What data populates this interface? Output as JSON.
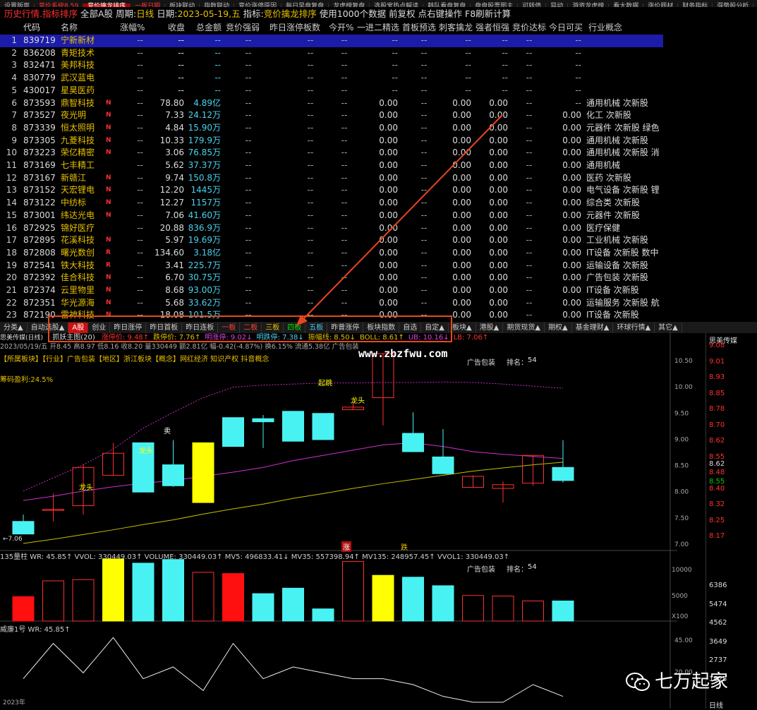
{
  "top_menu": [
    "设置版面",
    "竞价系统8.59",
    "竞价擒龙排序",
    "一板日期",
    "板块联动",
    "指数联动",
    "竞价涨停原因",
    "每日早盘复盘",
    "龙虎榜复盘",
    "选股宝热点解读",
    "韩队看盘复盘",
    "盘盘股票图主",
    "可转债",
    "异动",
    "游资龙虎榜",
    "看大数据",
    "涨价题材",
    "财务指标",
    "强势股分析",
    "主力"
  ],
  "infobar": {
    "a": "历史行情.指标排序",
    "b": "全部A股",
    "c": "周期:",
    "d": "日线",
    "e": "日期:",
    "f": "2023-05-19,五",
    "g": "指标:",
    "h": "竞价擒龙排序",
    "i": "使用1000个数据 前复权 点右键操作 F8刷新计算"
  },
  "table": {
    "headers": {
      "code": "代码",
      "name": "名称",
      "pct": "涨幅%",
      "close": "收盘",
      "mkt": "总金额",
      "amp": "竞价强弱",
      "boards": "昨日涨停板数",
      "open": "今开%",
      "j12": "一进二精选",
      "fboard": "首板预选",
      "dragon": "刺客擒龙",
      "strong": "强者恒强",
      "bid": "竞价达标",
      "buyable": "今日可买",
      "concept": "行业概念"
    },
    "rows": [
      {
        "idx": "1",
        "code": "839719",
        "name": "宁新新材",
        "flag": "",
        "pct": "--",
        "close": "--",
        "mkt": "--",
        "amp": "--",
        "boards": "--",
        "open": "--",
        "j12": "--",
        "fboard": "--",
        "dragon": "--",
        "strong": "--",
        "bid": "--",
        "buyable": "--",
        "concept": ""
      },
      {
        "idx": "2",
        "code": "836208",
        "name": "青矩技术",
        "flag": "",
        "pct": "--",
        "close": "--",
        "mkt": "--",
        "amp": "--",
        "boards": "--",
        "open": "--",
        "j12": "--",
        "fboard": "--",
        "dragon": "--",
        "strong": "--",
        "bid": "--",
        "buyable": "--",
        "concept": ""
      },
      {
        "idx": "3",
        "code": "832471",
        "name": "美邦科技",
        "flag": "",
        "pct": "--",
        "close": "--",
        "mkt": "--",
        "amp": "--",
        "boards": "--",
        "open": "--",
        "j12": "--",
        "fboard": "--",
        "dragon": "--",
        "strong": "--",
        "bid": "--",
        "buyable": "--",
        "concept": ""
      },
      {
        "idx": "4",
        "code": "830779",
        "name": "武汉蓝电",
        "flag": "",
        "pct": "--",
        "close": "--",
        "mkt": "--",
        "amp": "--",
        "boards": "--",
        "open": "--",
        "j12": "--",
        "fboard": "--",
        "dragon": "--",
        "strong": "--",
        "bid": "--",
        "buyable": "--",
        "concept": ""
      },
      {
        "idx": "5",
        "code": "430017",
        "name": "星昊医药",
        "flag": "",
        "pct": "--",
        "close": "--",
        "mkt": "--",
        "amp": "--",
        "boards": "--",
        "open": "--",
        "j12": "--",
        "fboard": "--",
        "dragon": "--",
        "strong": "--",
        "bid": "--",
        "buyable": "--",
        "concept": ""
      },
      {
        "idx": "6",
        "code": "873593",
        "name": "鼎智科技",
        "flag": "N",
        "pct": "--",
        "close": "78.80",
        "mkt": "4.89亿",
        "amp": "--",
        "boards": "--",
        "open": "--",
        "j12": "0.00",
        "fboard": "--",
        "dragon": "0.00",
        "strong": "0.00",
        "bid": "--",
        "buyable": "--",
        "concept": "通用机械  次新股"
      },
      {
        "idx": "7",
        "code": "873527",
        "name": "夜光明",
        "flag": "N",
        "pct": "--",
        "close": "7.33",
        "mkt": "24.12万",
        "amp": "--",
        "boards": "--",
        "open": "--",
        "j12": "0.00",
        "fboard": "--",
        "dragon": "0.00",
        "strong": "0.00",
        "bid": "--",
        "buyable": "0.00",
        "concept": "化工  次新股"
      },
      {
        "idx": "8",
        "code": "873339",
        "name": "恒太照明",
        "flag": "N",
        "pct": "--",
        "close": "4.84",
        "mkt": "15.90万",
        "amp": "--",
        "boards": "--",
        "open": "--",
        "j12": "0.00",
        "fboard": "--",
        "dragon": "0.00",
        "strong": "0.00",
        "bid": "--",
        "buyable": "0.00",
        "concept": "元器件  次新股 绿色"
      },
      {
        "idx": "9",
        "code": "873305",
        "name": "九菱科技",
        "flag": "N",
        "pct": "--",
        "close": "10.33",
        "mkt": "179.9万",
        "amp": "--",
        "boards": "--",
        "open": "--",
        "j12": "0.00",
        "fboard": "--",
        "dragon": "0.00",
        "strong": "0.00",
        "bid": "--",
        "buyable": "0.00",
        "concept": "通用机械  次新股"
      },
      {
        "idx": "10",
        "code": "873223",
        "name": "荣亿精密",
        "flag": "N",
        "pct": "--",
        "close": "3.06",
        "mkt": "76.85万",
        "amp": "--",
        "boards": "--",
        "open": "--",
        "j12": "0.00",
        "fboard": "--",
        "dragon": "0.00",
        "strong": "0.00",
        "bid": "--",
        "buyable": "0.00",
        "concept": "通用机械  次新股 消"
      },
      {
        "idx": "11",
        "code": "873169",
        "name": "七丰精工",
        "flag": "",
        "pct": "--",
        "close": "5.62",
        "mkt": "37.37万",
        "amp": "--",
        "boards": "--",
        "open": "--",
        "j12": "0.00",
        "fboard": "--",
        "dragon": "0.00",
        "strong": "0.00",
        "bid": "--",
        "buyable": "0.00",
        "concept": "通用机械"
      },
      {
        "idx": "12",
        "code": "873167",
        "name": "新赣江",
        "flag": "N",
        "pct": "--",
        "close": "9.74",
        "mkt": "150.8万",
        "amp": "--",
        "boards": "--",
        "open": "--",
        "j12": "0.00",
        "fboard": "--",
        "dragon": "0.00",
        "strong": "0.00",
        "bid": "--",
        "buyable": "0.00",
        "concept": "医药  次新股"
      },
      {
        "idx": "13",
        "code": "873152",
        "name": "天宏锂电",
        "flag": "N",
        "pct": "--",
        "close": "12.20",
        "mkt": "1445万",
        "amp": "--",
        "boards": "--",
        "open": "--",
        "j12": "0.00",
        "fboard": "--",
        "dragon": "0.00",
        "strong": "0.00",
        "bid": "--",
        "buyable": "0.00",
        "concept": "电气设备  次新股 锂"
      },
      {
        "idx": "14",
        "code": "873122",
        "name": "中纺标",
        "flag": "N",
        "pct": "--",
        "close": "12.27",
        "mkt": "1157万",
        "amp": "--",
        "boards": "--",
        "open": "--",
        "j12": "0.00",
        "fboard": "--",
        "dragon": "0.00",
        "strong": "0.00",
        "bid": "--",
        "buyable": "0.00",
        "concept": "综合类  次新股"
      },
      {
        "idx": "15",
        "code": "873001",
        "name": "纬达光电",
        "flag": "N",
        "pct": "--",
        "close": "7.06",
        "mkt": "41.60万",
        "amp": "--",
        "boards": "--",
        "open": "--",
        "j12": "0.00",
        "fboard": "--",
        "dragon": "0.00",
        "strong": "0.00",
        "bid": "--",
        "buyable": "0.00",
        "concept": "元器件  次新股"
      },
      {
        "idx": "16",
        "code": "872925",
        "name": "锦好医疗",
        "flag": "",
        "pct": "--",
        "close": "20.88",
        "mkt": "836.9万",
        "amp": "--",
        "boards": "--",
        "open": "--",
        "j12": "0.00",
        "fboard": "--",
        "dragon": "0.00",
        "strong": "0.00",
        "bid": "--",
        "buyable": "0.00",
        "concept": "医疗保健"
      },
      {
        "idx": "17",
        "code": "872895",
        "name": "花溪科技",
        "flag": "N",
        "pct": "--",
        "close": "5.97",
        "mkt": "19.69万",
        "amp": "--",
        "boards": "--",
        "open": "--",
        "j12": "0.00",
        "fboard": "--",
        "dragon": "0.00",
        "strong": "0.00",
        "bid": "--",
        "buyable": "0.00",
        "concept": "工业机械  次新股"
      },
      {
        "idx": "18",
        "code": "872808",
        "name": "曙光数创",
        "flag": "R",
        "pct": "--",
        "close": "134.60",
        "mkt": "3.18亿",
        "amp": "--",
        "boards": "--",
        "open": "--",
        "j12": "0.00",
        "fboard": "--",
        "dragon": "0.00",
        "strong": "0.00",
        "bid": "--",
        "buyable": "0.00",
        "concept": "IT设备  次新股 数中"
      },
      {
        "idx": "19",
        "code": "872541",
        "name": "铁大科技",
        "flag": "R",
        "pct": "--",
        "close": "3.41",
        "mkt": "225.7万",
        "amp": "--",
        "boards": "--",
        "open": "--",
        "j12": "0.00",
        "fboard": "--",
        "dragon": "0.00",
        "strong": "0.00",
        "bid": "--",
        "buyable": "0.00",
        "concept": "运输设备  次新股"
      },
      {
        "idx": "20",
        "code": "872392",
        "name": "佳合科技",
        "flag": "N",
        "pct": "--",
        "close": "6.70",
        "mkt": "30.75万",
        "amp": "--",
        "boards": "--",
        "open": "--",
        "j12": "0.00",
        "fboard": "--",
        "dragon": "0.00",
        "strong": "0.00",
        "bid": "--",
        "buyable": "0.00",
        "concept": "广告包装  次新股"
      },
      {
        "idx": "21",
        "code": "872374",
        "name": "云里物里",
        "flag": "N",
        "pct": "--",
        "close": "8.68",
        "mkt": "93.00万",
        "amp": "--",
        "boards": "--",
        "open": "--",
        "j12": "0.00",
        "fboard": "--",
        "dragon": "0.00",
        "strong": "0.00",
        "bid": "--",
        "buyable": "0.00",
        "concept": "IT设备  次新股"
      },
      {
        "idx": "22",
        "code": "872351",
        "name": "华光源海",
        "flag": "N",
        "pct": "--",
        "close": "5.68",
        "mkt": "33.62万",
        "amp": "--",
        "boards": "--",
        "open": "--",
        "j12": "0.00",
        "fboard": "--",
        "dragon": "0.00",
        "strong": "0.00",
        "bid": "--",
        "buyable": "0.00",
        "concept": "运输服务  次新股 航"
      },
      {
        "idx": "23",
        "code": "872190",
        "name": "雷神科技",
        "flag": "N",
        "pct": "--",
        "close": "18.08",
        "mkt": "101.5万",
        "amp": "--",
        "boards": "--",
        "open": "--",
        "j12": "0.00",
        "fboard": "--",
        "dragon": "0.00",
        "strong": "0.00",
        "bid": "--",
        "buyable": "0.00",
        "concept": "IT设备  次新股"
      }
    ]
  },
  "tabs": [
    "分类▲",
    "自动选股▲",
    "A股",
    "创业",
    "昨日涨停",
    "昨日首板",
    "昨日连板",
    "一板",
    "二板",
    "三板",
    "四板",
    "五板",
    "昨曾涨停",
    "板块指数",
    "自选",
    "自定▲",
    "板块▲",
    "港股▲",
    "期货现货▲",
    "期权▲",
    "基金理财▲",
    "环球行情▲",
    "其它▲"
  ],
  "chart_info": {
    "line1_title": "思美传媒(日线)",
    "indicator": "抓妖主图(20)",
    "kv": [
      "涨停价: 9.48↑",
      "跌停价: 7.76↑",
      "明涨停: 9.02↓",
      "明跌停: 7.38↓",
      "振幅线: 8.50↓",
      "BOLL: 8.61↑",
      "UB: 10.16↓",
      "LB: 7.06↑"
    ],
    "stats": "2023/05/19/五 开8.45 高8.97 低8.16 收8.20 量330449 额2.81亿 幅-0.42(-4.87%) 换6.15% 流通5.38亿 广告包装",
    "tags": "【所属板块】【行业】广告包装【地区】浙江板块【概念】网红经济 知识产权 抖音概念",
    "profit": "筹码盈利:24.5%",
    "sector_label": "广告包装",
    "rank_label": "排名：",
    "rank": "54",
    "vol_line": "135量柱 WR: 45.85↑ VVOL: 330449.03↑ VOLUME: 330449.03↑ MV5: 496833.41↓ MV35: 557398.94↑ MV135: 248957.45↑ VVOL1: 330449.03↑",
    "wr_line": "威廉1号 WR: 45.85↑",
    "price_axis": [
      "10.50",
      "10.00",
      "9.50",
      "9.00",
      "8.50",
      "8.00",
      "7.50",
      "7.00"
    ],
    "vol_axis": [
      "10000",
      "5000",
      "X100"
    ],
    "wr_axis": [
      "45.00",
      "20.00"
    ],
    "low_marker": "←7.06",
    "marks": [
      "龙头",
      "龙头",
      "起跳",
      "龙头",
      "卖"
    ],
    "up": "涨",
    "down": "跌",
    "year": "2023年"
  },
  "chart_data": {
    "type": "candlestick",
    "title": "思美传媒(日线)",
    "ohlc": [
      {
        "o": 7.42,
        "h": 7.55,
        "l": 7.18,
        "c": 7.18
      },
      {
        "o": 7.65,
        "h": 7.95,
        "l": 7.42,
        "c": 7.65
      },
      {
        "o": 7.72,
        "h": 8.52,
        "l": 7.55,
        "c": 8.45
      },
      {
        "o": 8.3,
        "h": 8.92,
        "l": 8.3,
        "c": 8.72
      },
      {
        "o": 8.92,
        "h": 8.92,
        "l": 7.98,
        "c": 7.98
      },
      {
        "o": 8.5,
        "h": 8.97,
        "l": 8.08,
        "c": 8.1
      },
      {
        "o": 7.78,
        "h": 8.92,
        "l": 7.78,
        "c": 8.92
      },
      {
        "o": 9.4,
        "h": 9.4,
        "l": 8.85,
        "c": 8.85
      },
      {
        "o": 9.38,
        "h": 9.45,
        "l": 8.82,
        "c": 9.32
      },
      {
        "o": 9.52,
        "h": 9.52,
        "l": 8.95,
        "c": 8.95
      },
      {
        "o": 9.48,
        "h": 9.48,
        "l": 8.98,
        "c": 8.98
      },
      {
        "o": 9.55,
        "h": 9.7,
        "l": 9.55,
        "c": 9.6
      },
      {
        "o": 9.78,
        "h": 10.62,
        "l": 9.25,
        "c": 10.62
      },
      {
        "o": 9.1,
        "h": 9.5,
        "l": 8.75,
        "c": 8.75
      },
      {
        "o": 8.65,
        "h": 9.18,
        "l": 8.35,
        "c": 8.33
      },
      {
        "o": 8.07,
        "h": 8.3,
        "l": 8.07,
        "c": 8.28
      },
      {
        "o": 8.05,
        "h": 8.18,
        "l": 7.78,
        "c": 8.12
      },
      {
        "o": 8.15,
        "h": 8.68,
        "l": 8.1,
        "c": 8.68
      },
      {
        "o": 8.45,
        "h": 8.97,
        "l": 8.16,
        "c": 8.2
      }
    ],
    "boll_mid": [
      7.82,
      7.9,
      8.0,
      8.08,
      8.15,
      8.2,
      8.28,
      8.36,
      8.45,
      8.58,
      8.68,
      8.78,
      8.88,
      8.92,
      8.85,
      8.75,
      8.7,
      8.66,
      8.62
    ],
    "ma_yellow": [
      7.0,
      7.08,
      7.17,
      7.26,
      7.36,
      7.45,
      7.56,
      7.66,
      7.75,
      7.86,
      7.95,
      8.05,
      8.14,
      8.22,
      8.3,
      8.38,
      8.44,
      8.5,
      8.55
    ],
    "upper_band": [
      8.0,
      8.25,
      8.5,
      8.8,
      9.2,
      9.5,
      9.78,
      9.98,
      10.02,
      10.04,
      10.06,
      10.06,
      10.07,
      10.07,
      10.08,
      10.07,
      10.04,
      10.0,
      9.96
    ],
    "volume": [
      4000,
      6600,
      6800,
      10200,
      9500,
      10100,
      8000,
      7800,
      4500,
      5400,
      2000,
      9800,
      7500,
      7200,
      5800,
      4200,
      4100,
      3300,
      3300
    ],
    "wr": [
      40,
      10,
      35,
      5,
      40,
      30,
      50,
      10,
      40,
      30,
      35,
      40,
      40,
      45,
      55,
      60,
      60,
      45,
      55
    ]
  },
  "right_panel": {
    "title": "思美传媒",
    "prices": [
      "9.08",
      "9.01",
      "8.93",
      "8.85",
      "8.78",
      "8.70",
      "8.62",
      "8.55",
      "8.48",
      "8.40",
      "8.32",
      "8.25",
      "8.17"
    ],
    "vol": [
      "6386",
      "5474",
      "4562",
      "3649",
      "2737",
      "1825"
    ],
    "last": "8.62",
    "last2": "8.55",
    "bottom": "日线"
  },
  "watermark": "www.zbzfwu.com",
  "wechat_label": "七万起家",
  "colors": {
    "up": "#ff3030",
    "down": "#49f2f2",
    "yellow": "#ffff00",
    "magenta": "#e040e0",
    "arrow": "#e8451e"
  }
}
